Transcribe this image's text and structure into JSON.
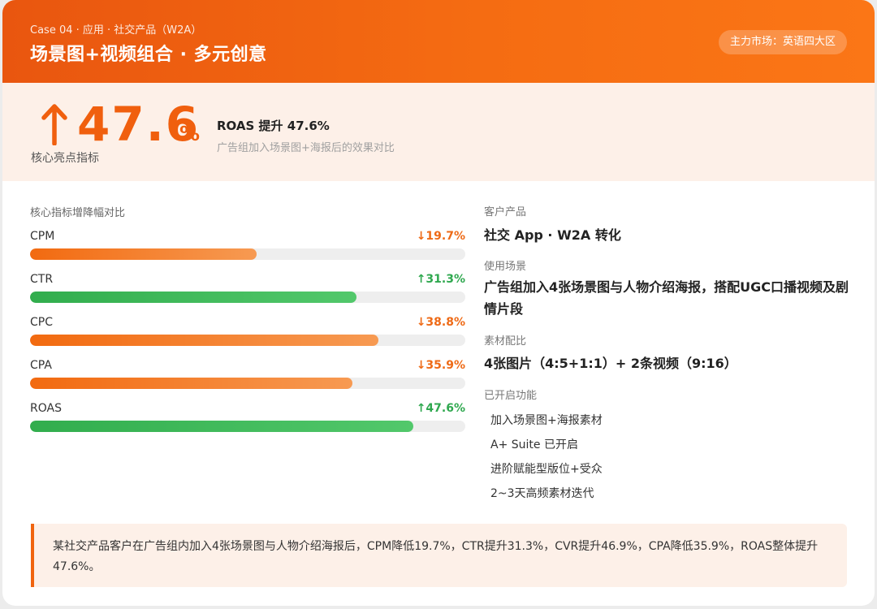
{
  "header": {
    "breadcrumb": "Case 04 · 应用 · 社交产品（W2A）",
    "title": "场景图+视频组合 · 多元创意",
    "market": "主力市场：英语四大区"
  },
  "highlight": {
    "value": "47.6",
    "unit": "%",
    "caption": "核心亮点指标",
    "headline": "ROAS 提升 47.6%",
    "subline": "广告组加入场景图+海报后的效果对比"
  },
  "metrics": {
    "title": "核心指标增降幅对比",
    "items": [
      {
        "name": "CPM",
        "change": "↓19.7%",
        "direction": "down",
        "fill_fraction": 0.52
      },
      {
        "name": "CTR",
        "change": "↑31.3%",
        "direction": "up",
        "fill_fraction": 0.75
      },
      {
        "name": "CPC",
        "change": "↓38.8%",
        "direction": "down",
        "fill_fraction": 0.8
      },
      {
        "name": "CPA",
        "change": "↓35.9%",
        "direction": "down",
        "fill_fraction": 0.74
      },
      {
        "name": "ROAS",
        "change": "↑47.6%",
        "direction": "up",
        "fill_fraction": 0.88
      }
    ]
  },
  "info": {
    "product_label": "客户产品",
    "product_value": "社交 App · W2A 转化",
    "scenario_label": "使用场景",
    "scenario_value": "广告组加入4张场景图与人物介绍海报，搭配UGC口播视频及剧情片段",
    "ratio_label": "素材配比",
    "ratio_value": "4张图片（4:5+1:1）+ 2条视频（9:16）",
    "features_label": "已开启功能",
    "features": [
      "加入场景图+海报素材",
      "A+ Suite 已开启",
      "进阶赋能型版位+受众",
      "2~3天高频素材迭代"
    ]
  },
  "summary": {
    "text": "某社交产品客户在广告组内加入4张场景图与人物介绍海报后，CPM降低19.7%，CTR提升31.3%，CVR提升46.9%，CPA降低35.9%，ROAS整体提升47.6%。"
  },
  "colors": {
    "accent": "#f05f0e",
    "down": "#ee6a16",
    "up": "#2fa84f",
    "highlight_bg": "#fdf0e8"
  },
  "icons": {
    "highlight_arrow": "arrow-up-icon"
  }
}
